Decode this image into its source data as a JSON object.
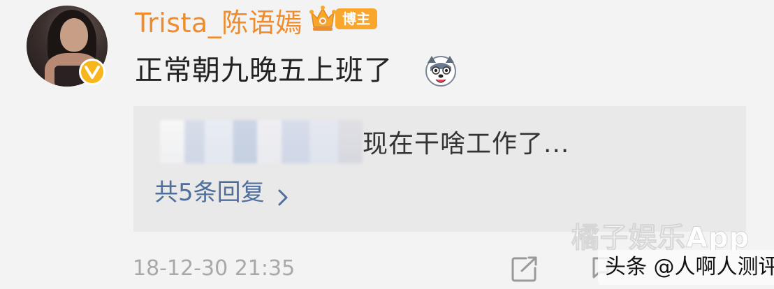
{
  "post": {
    "username": "Trista_陈语嫣",
    "badge_label": "博主",
    "text": "正常朝九晚五上班了",
    "timestamp": "18-12-30 21:35"
  },
  "comment": {
    "text": "现在干啥工作了...",
    "replies_label": "共5条回复"
  },
  "watermark": "橘子娱乐App",
  "source_overlay": "头条 @人啊人测评",
  "colors": {
    "username": "#f08c2b",
    "badge": "#f8a72c",
    "verified": "#f8b51c",
    "link": "#4f6e9c",
    "timestamp": "#a8a8a8"
  },
  "icons": {
    "verified": "verified-v-icon",
    "crown": "crown-icon",
    "emoji": "dog-face-emoji-icon",
    "chevron": "chevron-right-icon",
    "share": "share-edit-icon",
    "comment": "comment-icon"
  }
}
